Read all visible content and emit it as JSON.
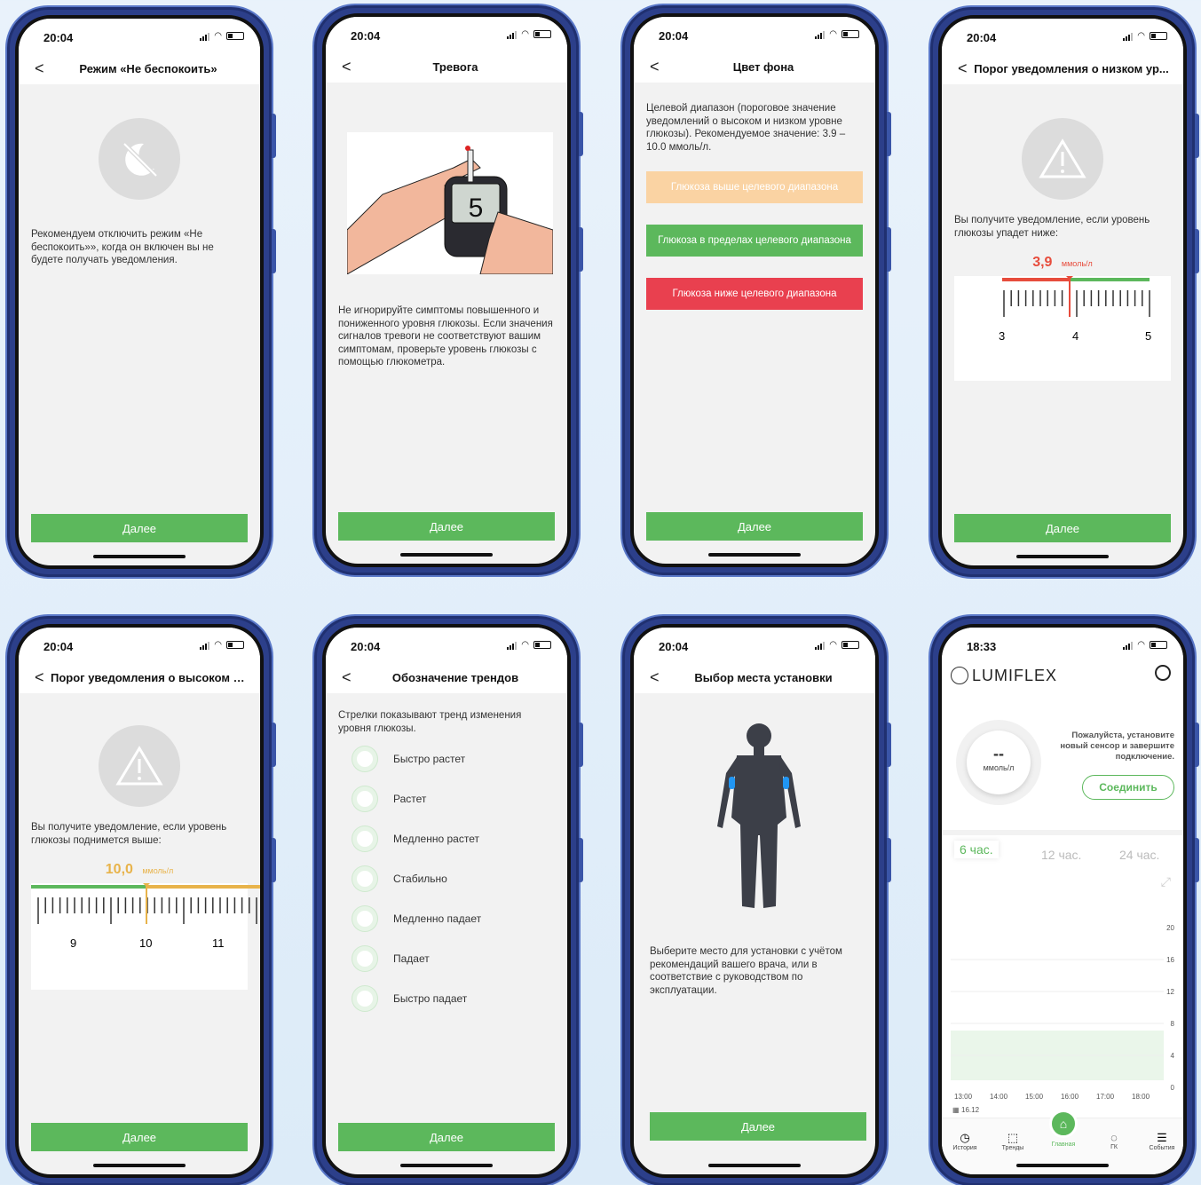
{
  "common": {
    "time": "20:04",
    "next": "Далее",
    "back": "<"
  },
  "p1": {
    "title": "Режим «Не беспокоить»",
    "text": "Рекомендуем отключить режим «Не беспокоить»», когда он включен вы не будете получать уведомления."
  },
  "p2": {
    "title": "Тревога",
    "text": "Не игнорируйте симптомы повышенного и пониженного уровня глюкозы. Если значения сигналов тревоги не соответствуют вашим симптомам, проверьте уровень глюкозы с помощью глюкометра.",
    "meter_value": "5"
  },
  "p3": {
    "title": "Цвет фона",
    "text": "Целевой диапазон (пороговое значение уведомлений о высоком и низком уровне глюкозы). Рекомендуемое значение: 3.9 – 10.0 ммоль/л.",
    "bars": [
      {
        "label": "Глюкоза выше целевого диапазона",
        "color": "#fad3a3"
      },
      {
        "label": "Глюкоза в пределах целевого диапазона",
        "color": "#5cb85c"
      },
      {
        "label": "Глюкоза ниже целевого диапазона",
        "color": "#e9404f"
      }
    ]
  },
  "p4": {
    "title": "Порог уведомления о низком ур...",
    "text": "Вы получите уведомление, если уровень глюкозы упадет ниже:",
    "value": "3,9",
    "unit": "ммоль/л",
    "ticks": [
      "3",
      "4",
      "5"
    ]
  },
  "p5": {
    "title": "Порог уведомления о высоком у...",
    "text": "Вы получите уведомление, если уровень глюкозы поднимется выше:",
    "value": "10,0",
    "unit": "ммоль/л",
    "ticks": [
      "9",
      "10",
      "11"
    ]
  },
  "p6": {
    "title": "Обозначение трендов",
    "text": "Стрелки показывают тренд изменения уровня глюкозы.",
    "items": [
      "Быстро растет",
      "Растет",
      "Медленно растет",
      "Стабильно",
      "Медленно падает",
      "Падает",
      "Быстро падает"
    ]
  },
  "p7": {
    "title": "Выбор места установки",
    "text": "Выберите место для установки с учётом рекомендаций вашего врача, или в соответствие с руководством по эксплуатации."
  },
  "p8": {
    "time": "18:33",
    "logo": "LUMIFLEX",
    "value": "--",
    "unit": "ммоль/л",
    "message": "Пожалуйста, установите новый сенсор и завершите подключение.",
    "connect": "Соединить",
    "ranges": [
      "6 час.",
      "12 час.",
      "24 час."
    ],
    "yticks": [
      "20",
      "16",
      "12",
      "8",
      "4",
      "0"
    ],
    "xticks": [
      "13:00",
      "14:00",
      "15:00",
      "16:00",
      "17:00",
      "18:00"
    ],
    "date": "16.12",
    "nav": [
      "История",
      "Тренды",
      "Главная",
      "ГК",
      "События"
    ]
  }
}
